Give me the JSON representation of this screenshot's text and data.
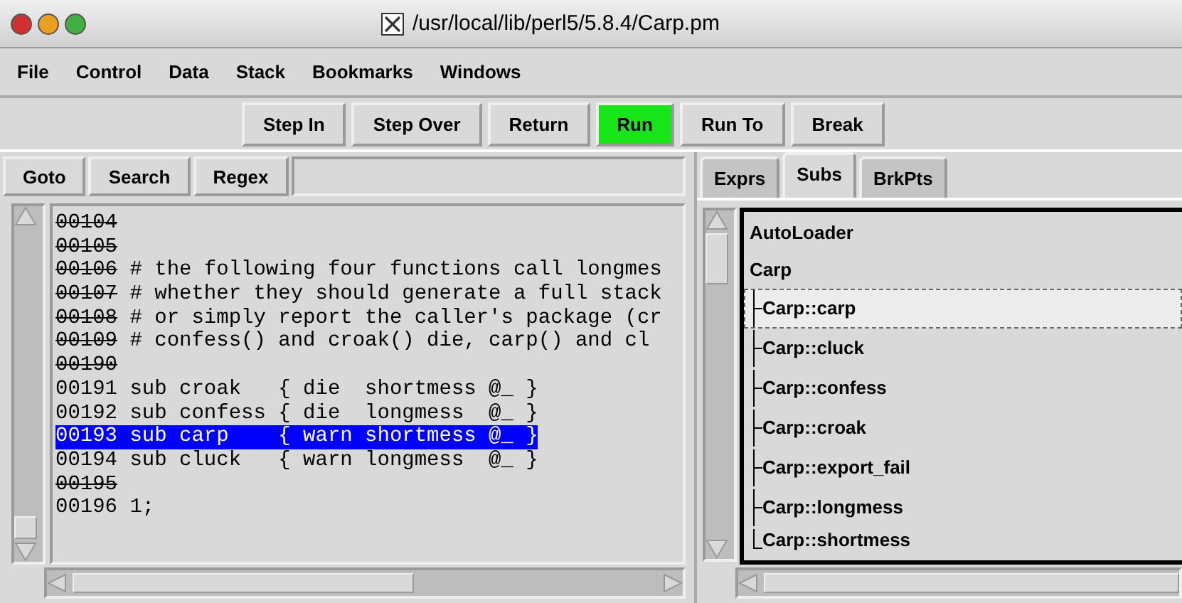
{
  "window": {
    "title": "/usr/local/lib/perl5/5.8.4/Carp.pm"
  },
  "menu": [
    "File",
    "Control",
    "Data",
    "Stack",
    "Bookmarks",
    "Windows"
  ],
  "toolbar": [
    {
      "label": "Step In",
      "active": false
    },
    {
      "label": "Step Over",
      "active": false
    },
    {
      "label": "Return",
      "active": false
    },
    {
      "label": "Run",
      "active": true
    },
    {
      "label": "Run To",
      "active": false
    },
    {
      "label": "Break",
      "active": false
    }
  ],
  "search_bar": {
    "buttons": [
      "Goto",
      "Search",
      "Regex"
    ]
  },
  "code": [
    {
      "line": "00104",
      "struck": true,
      "selected": false
    },
    {
      "line": "00105",
      "struck": true,
      "selected": false
    },
    {
      "line": "00106",
      "text": " # the following four functions call longmes",
      "struck": true,
      "selected": false
    },
    {
      "line": "00107",
      "text": " # whether they should generate a full stack",
      "struck": true,
      "selected": false
    },
    {
      "line": "00108",
      "text": " # or simply report the caller's package (cr",
      "struck": true,
      "selected": false
    },
    {
      "line": "00109",
      "text": " # confess() and croak() die, carp() and cl",
      "struck": true,
      "selected": false
    },
    {
      "line": "00190",
      "struck": true,
      "selected": false
    },
    {
      "line": "00191",
      "text": " sub croak   { die  shortmess @_ }",
      "struck": false,
      "selected": false
    },
    {
      "line": "00192",
      "text": " sub confess { die  longmess  @_ }",
      "struck": false,
      "selected": false
    },
    {
      "line": "00193",
      "text": " sub carp    { warn shortmess @_ }",
      "struck": false,
      "selected": true
    },
    {
      "line": "00194",
      "text": " sub cluck   { warn longmess  @_ }",
      "struck": false,
      "selected": false
    },
    {
      "line": "00195",
      "struck": true,
      "selected": false
    },
    {
      "line": "00196",
      "text": " 1;",
      "struck": false,
      "selected": false
    }
  ],
  "tabs": [
    {
      "label": "Exprs",
      "selected": false
    },
    {
      "label": "Subs",
      "selected": true
    },
    {
      "label": "BrkPts",
      "selected": false
    }
  ],
  "tree": [
    {
      "label": "AutoLoader",
      "selected": false
    },
    {
      "label": "Carp",
      "selected": false,
      "children": [
        {
          "label": "Carp::carp",
          "selected": true
        },
        {
          "label": "Carp::cluck",
          "selected": false
        },
        {
          "label": "Carp::confess",
          "selected": false
        },
        {
          "label": "Carp::croak",
          "selected": false
        },
        {
          "label": "Carp::export_fail",
          "selected": false
        },
        {
          "label": "Carp::longmess",
          "selected": false
        },
        {
          "label": "Carp::shortmess",
          "selected": false
        }
      ]
    }
  ]
}
